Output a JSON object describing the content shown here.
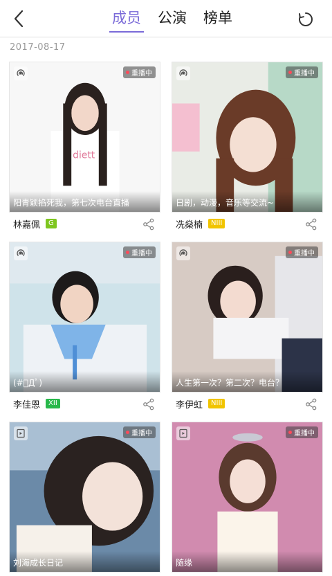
{
  "header": {
    "tabs": [
      {
        "label": "成员",
        "active": true
      },
      {
        "label": "公演",
        "active": false
      },
      {
        "label": "榜单",
        "active": false
      }
    ],
    "back_icon": "chevron-left-icon",
    "refresh_icon": "refresh-icon",
    "accent_color": "#7a6ad8"
  },
  "date": "2017-08-17",
  "cards": [
    {
      "caption": "阳青颖掐死我，第七次电台直播",
      "name": "林嘉佩",
      "team": "G",
      "team_color": "#7ec61f",
      "badge": "重播中",
      "type_icon": "radio-icon"
    },
    {
      "caption": "日剧，动漫，音乐等交流~",
      "name": "冼燊楠",
      "team": "NIII",
      "team_color": "#f1c400",
      "badge": "重播中",
      "type_icon": "radio-icon"
    },
    {
      "caption": "(#ﾟДﾟ)",
      "name": "李佳恩",
      "team": "XII",
      "team_color": "#27b84a",
      "badge": "重播中",
      "type_icon": "radio-icon"
    },
    {
      "caption": "人生第一次？第二次？电台？",
      "name": "李伊虹",
      "team": "NIII",
      "team_color": "#f1c400",
      "badge": "重播中",
      "type_icon": "radio-icon"
    },
    {
      "caption": "刘海成长日记",
      "name": "",
      "team": "",
      "team_color": "",
      "badge": "重播中",
      "type_icon": "video-icon"
    },
    {
      "caption": "随缘",
      "name": "",
      "team": "",
      "team_color": "",
      "badge": "重播中",
      "type_icon": "video-icon"
    }
  ]
}
